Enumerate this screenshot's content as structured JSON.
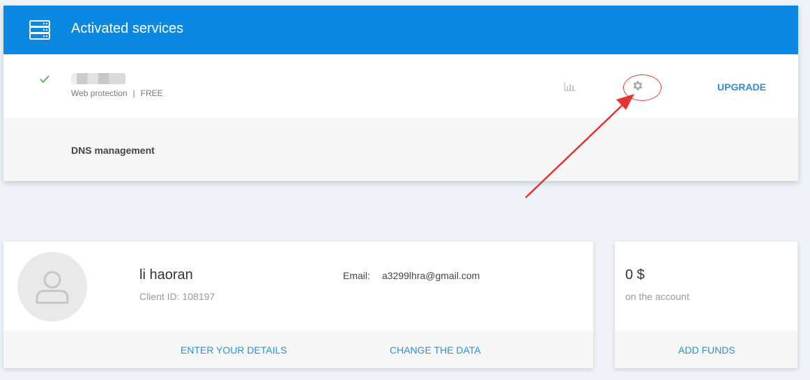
{
  "services": {
    "title": "Activated services",
    "row": {
      "type": "Web protection",
      "separator": "|",
      "plan": "FREE",
      "upgrade": "UPGRADE"
    },
    "dns": "DNS management"
  },
  "profile": {
    "name": "li haoran",
    "client_id": "Client ID: 108197",
    "email_label": "Email:",
    "email": "a3299lhra@gmail.com",
    "enter_details": "ENTER YOUR DETAILS",
    "change_data": "CHANGE THE DATA"
  },
  "balance": {
    "amount": "0 $",
    "subtitle": "on the account",
    "add_funds": "ADD FUNDS"
  },
  "colors": {
    "header_blue": "#0a88e2",
    "link_blue": "#2d8fd6",
    "annotation_red": "#e33333",
    "check_green": "#4caf50"
  },
  "icons": {
    "header": "server-icon",
    "status": "check-icon",
    "stats": "bar-chart-icon",
    "settings": "gear-icon",
    "avatar": "user-icon"
  }
}
